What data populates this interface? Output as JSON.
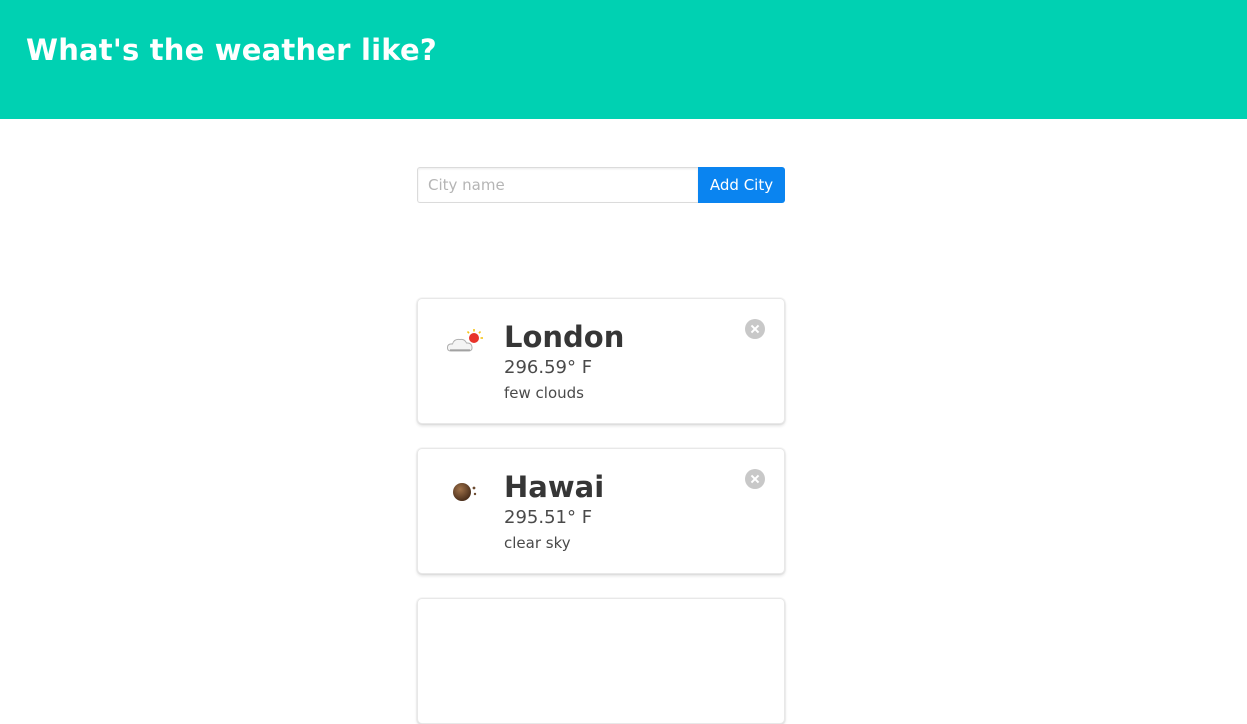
{
  "header": {
    "title": "What's the weather like?",
    "background_color": "#00d1b2"
  },
  "search": {
    "placeholder": "City name",
    "value": "",
    "button_label": "Add City",
    "button_color": "#0a84f0"
  },
  "cities": [
    {
      "name": "London",
      "temperature": "296.59° F",
      "description": "few clouds",
      "icon": "few-clouds-icon"
    },
    {
      "name": "Hawai",
      "temperature": "295.51° F",
      "description": "clear sky",
      "icon": "clear-sky-night-icon"
    }
  ]
}
